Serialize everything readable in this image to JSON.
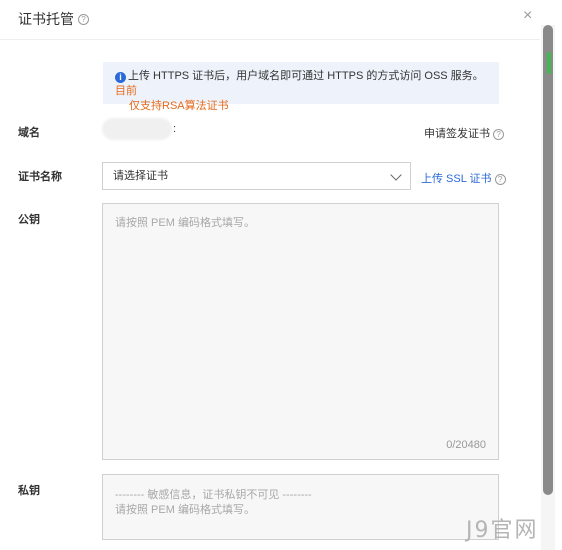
{
  "header": {
    "title": "证书托管",
    "help_glyph": "?",
    "close_glyph": "×"
  },
  "notice": {
    "info_glyph": "i",
    "text_main": "上传 HTTPS 证书后，用户域名即可通过 HTTPS 的方式访问 OSS 服务。",
    "text_warn_1": "目前",
    "text_warn_2": "仅支持RSA算法证书"
  },
  "form": {
    "domain": {
      "label": "域名",
      "colon": ":",
      "apply_link": "申请签发证书"
    },
    "cert_name": {
      "label": "证书名称",
      "placeholder": "请选择证书",
      "upload_link": "上传 SSL 证书"
    },
    "public_key": {
      "label": "公钥",
      "placeholder": "请按照 PEM 编码格式填写。",
      "counter": "0/20480"
    },
    "private_key": {
      "label": "私钥",
      "placeholder_line1": "-------- 敏感信息，证书私钥不可见 --------",
      "placeholder_line2": "请按照 PEM 编码格式填写。"
    }
  },
  "watermark": "J9官网",
  "colors": {
    "accent_blue": "#2a6ad8",
    "warn_orange": "#e46a1a",
    "notice_bg": "#eef3fb"
  }
}
